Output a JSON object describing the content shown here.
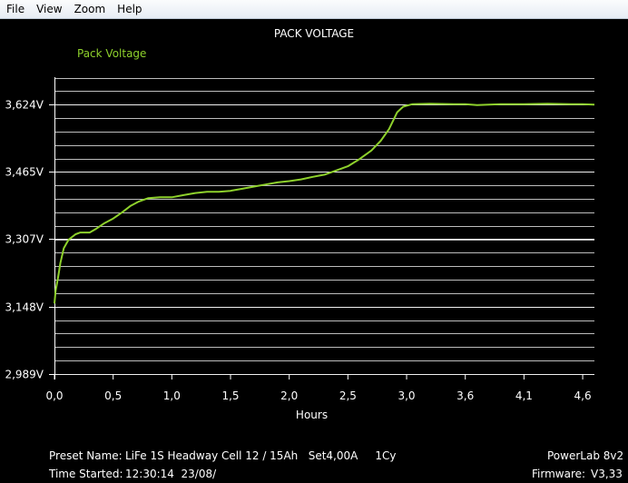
{
  "menu": {
    "items": [
      "File",
      "View",
      "Zoom",
      "Help"
    ]
  },
  "chart_data": {
    "type": "line",
    "title": "PACK VOLTAGE",
    "xlabel": "Hours",
    "ylabel": "",
    "xlim": [
      0,
      4.6
    ],
    "ylim": [
      2.989,
      3.6875
    ],
    "y_ticks": [
      {
        "value": 2.989,
        "label": "2,989V"
      },
      {
        "value": 3.148,
        "label": "3,148V"
      },
      {
        "value": 3.307,
        "label": "3,307V"
      },
      {
        "value": 3.465,
        "label": "3,465V"
      },
      {
        "value": 3.624,
        "label": "3,624V"
      }
    ],
    "x_ticks": [
      {
        "value": 0.0,
        "label": "0,0"
      },
      {
        "value": 0.5,
        "label": "0,5"
      },
      {
        "value": 1.0,
        "label": "1,0"
      },
      {
        "value": 1.5,
        "label": "1,5"
      },
      {
        "value": 2.0,
        "label": "2,0"
      },
      {
        "value": 2.5,
        "label": "2,5"
      },
      {
        "value": 3.0,
        "label": "3,0"
      },
      {
        "value": 3.5,
        "label": "3,6"
      },
      {
        "value": 4.0,
        "label": "4,1"
      },
      {
        "value": 4.5,
        "label": "4,6"
      }
    ],
    "grid_minor_step": 0.0317,
    "grid": true,
    "legend_position": "top-left",
    "series": [
      {
        "name": "Pack Voltage",
        "color": "#8ed12c",
        "points": [
          [
            0.0,
            3.155
          ],
          [
            0.01,
            3.185
          ],
          [
            0.03,
            3.215
          ],
          [
            0.05,
            3.25
          ],
          [
            0.08,
            3.285
          ],
          [
            0.12,
            3.305
          ],
          [
            0.18,
            3.318
          ],
          [
            0.22,
            3.322
          ],
          [
            0.3,
            3.322
          ],
          [
            0.35,
            3.33
          ],
          [
            0.42,
            3.343
          ],
          [
            0.5,
            3.355
          ],
          [
            0.58,
            3.37
          ],
          [
            0.65,
            3.385
          ],
          [
            0.72,
            3.395
          ],
          [
            0.8,
            3.403
          ],
          [
            0.9,
            3.405
          ],
          [
            1.0,
            3.405
          ],
          [
            1.1,
            3.41
          ],
          [
            1.2,
            3.415
          ],
          [
            1.3,
            3.418
          ],
          [
            1.4,
            3.418
          ],
          [
            1.5,
            3.42
          ],
          [
            1.6,
            3.425
          ],
          [
            1.7,
            3.43
          ],
          [
            1.8,
            3.435
          ],
          [
            1.9,
            3.44
          ],
          [
            2.0,
            3.443
          ],
          [
            2.1,
            3.447
          ],
          [
            2.2,
            3.453
          ],
          [
            2.3,
            3.458
          ],
          [
            2.4,
            3.468
          ],
          [
            2.5,
            3.478
          ],
          [
            2.6,
            3.495
          ],
          [
            2.7,
            3.515
          ],
          [
            2.78,
            3.538
          ],
          [
            2.85,
            3.565
          ],
          [
            2.92,
            3.605
          ],
          [
            2.97,
            3.618
          ],
          [
            3.05,
            3.624
          ],
          [
            3.2,
            3.625
          ],
          [
            3.4,
            3.624
          ],
          [
            3.5,
            3.624
          ],
          [
            3.6,
            3.622
          ],
          [
            3.8,
            3.624
          ],
          [
            4.0,
            3.624
          ],
          [
            4.2,
            3.625
          ],
          [
            4.4,
            3.624
          ],
          [
            4.5,
            3.624
          ],
          [
            4.6,
            3.623
          ]
        ]
      }
    ]
  },
  "info": {
    "preset_label": "Preset Name:",
    "preset_value": "LiFe 1S Headway Cell 12 / 15Ah   Set4,00A     1Cy",
    "time_label": "Time Started:",
    "time_value": "12:30:14  23/08/",
    "device": "PowerLab 8v2",
    "firmware_label": "Firmware:",
    "firmware_value": "V3,33"
  }
}
